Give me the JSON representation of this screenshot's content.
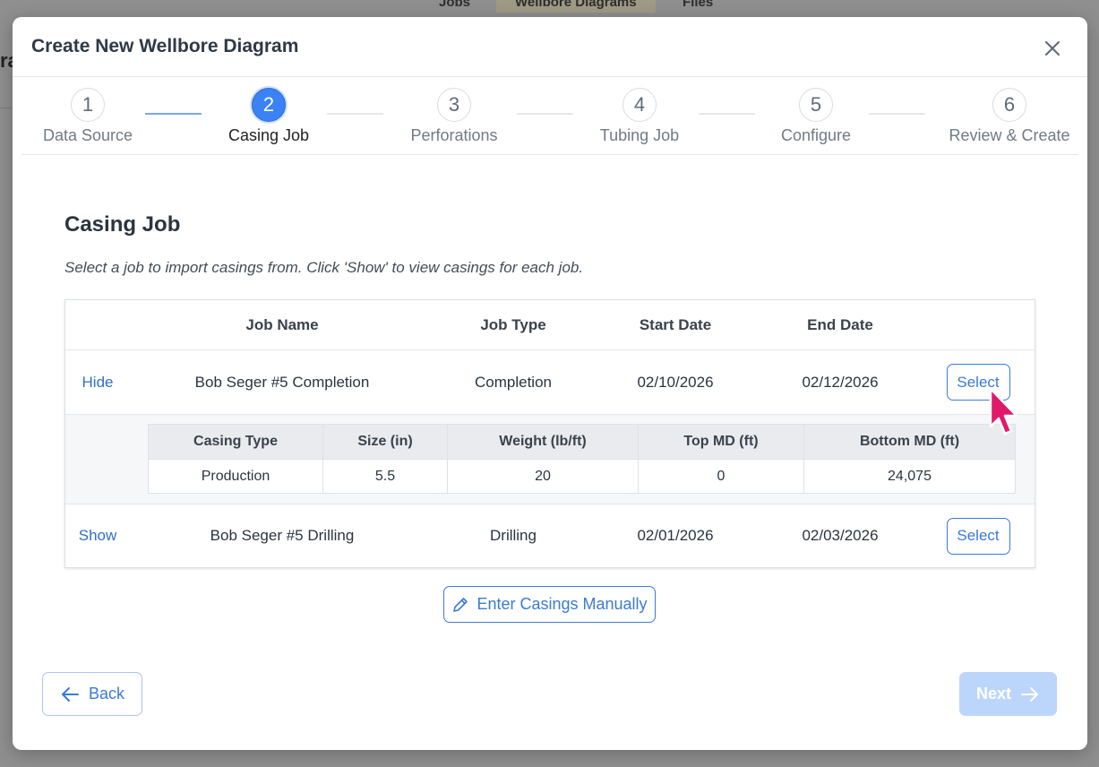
{
  "background": {
    "tabs": [
      "Jobs",
      "Wellbore Diagrams",
      "Files"
    ],
    "left_fragment": "ra"
  },
  "modal": {
    "title": "Create New Wellbore Diagram"
  },
  "stepper": {
    "steps": [
      {
        "number": "1",
        "label": "Data Source"
      },
      {
        "number": "2",
        "label": "Casing Job"
      },
      {
        "number": "3",
        "label": "Perforations"
      },
      {
        "number": "4",
        "label": "Tubing Job"
      },
      {
        "number": "5",
        "label": "Configure"
      },
      {
        "number": "6",
        "label": "Review & Create"
      }
    ],
    "active_step": 2
  },
  "content": {
    "title": "Casing Job",
    "subtitle": "Select a job to import casings from. Click 'Show' to view casings for each job."
  },
  "jobs_table": {
    "headers": [
      "Job Name",
      "Job Type",
      "Start Date",
      "End Date"
    ],
    "rows": [
      {
        "toggle": "Hide",
        "name": "Bob Seger #5 Completion",
        "type": "Completion",
        "start": "02/10/2026",
        "end": "02/12/2026",
        "action": "Select"
      },
      {
        "toggle": "Show",
        "name": "Bob Seger #5 Drilling",
        "type": "Drilling",
        "start": "02/01/2026",
        "end": "02/03/2026",
        "action": "Select"
      }
    ],
    "casings": {
      "headers": [
        "Casing Type",
        "Size (in)",
        "Weight (lb/ft)",
        "Top MD (ft)",
        "Bottom MD (ft)"
      ],
      "rows": [
        [
          "Production",
          "5.5",
          "20",
          "0",
          "24,075"
        ]
      ]
    }
  },
  "buttons": {
    "manual": "Enter Casings Manually",
    "back": "Back",
    "next": "Next"
  },
  "colors": {
    "accent": "#3b82f6",
    "link": "#2f6fc9",
    "next_disabled": "#bcd5fb",
    "cursor": "#e0196b"
  },
  "icons": {
    "close": "close-icon",
    "pencil": "pencil-icon",
    "back_arrow": "arrow-left-icon",
    "next_arrow": "arrow-right-icon"
  }
}
